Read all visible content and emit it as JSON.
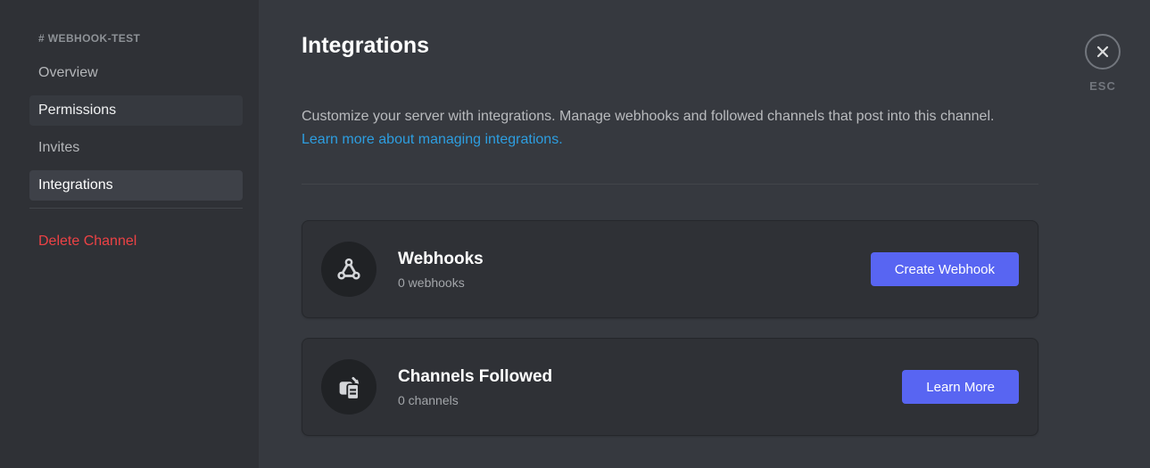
{
  "sidebar": {
    "channel_header": "# WEBHOOK-TEST",
    "items": [
      {
        "label": "Overview",
        "state": "default"
      },
      {
        "label": "Permissions",
        "state": "hover"
      },
      {
        "label": "Invites",
        "state": "default"
      },
      {
        "label": "Integrations",
        "state": "selected"
      }
    ],
    "delete_label": "Delete Channel"
  },
  "main": {
    "title": "Integrations",
    "description": "Customize your server with integrations. Manage webhooks and followed channels that post into this channel.",
    "link": "Learn more about managing integrations.",
    "cards": [
      {
        "icon": "webhook-icon",
        "title": "Webhooks",
        "subtitle": "0 webhooks",
        "button": "Create Webhook"
      },
      {
        "icon": "channels-followed-icon",
        "title": "Channels Followed",
        "subtitle": "0 channels",
        "button": "Learn More"
      }
    ]
  },
  "close": {
    "esc_label": "ESC"
  },
  "colors": {
    "accent_blurple": "#5865f2",
    "link_blue": "#2d9ee0",
    "danger_red": "#ed4245",
    "sidebar_bg": "#2f3136",
    "main_bg": "#36393f",
    "card_bg": "#2f3136",
    "avatar_bg": "#202225"
  }
}
